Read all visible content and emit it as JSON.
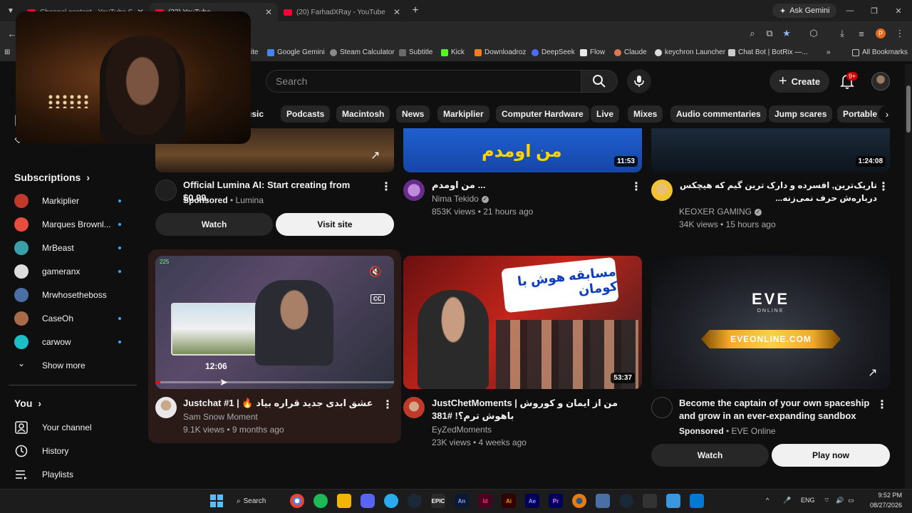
{
  "browser": {
    "tabs": [
      {
        "label": "Channel content - YouTube Stu"
      },
      {
        "label": "(22) YouTube"
      },
      {
        "label": "(20) FarhadXRay - YouTube"
      }
    ],
    "ask_gemini": "Ask Gemini",
    "profile_initial": "P"
  },
  "bookmarks": [
    {
      "label": "ite"
    },
    {
      "label": "Google Gemini",
      "color": "#4285f4"
    },
    {
      "label": "Steam Calculator",
      "color": "#8a8a8a"
    },
    {
      "label": "Subtitle",
      "color": "#6a6a6a"
    },
    {
      "label": "Kick",
      "color": "#53fc18"
    },
    {
      "label": "Downloadroz",
      "color": "#ff7a1a"
    },
    {
      "label": "DeepSeek",
      "color": "#4d6bfe"
    },
    {
      "label": "Flow",
      "color": "#e8e8e8"
    },
    {
      "label": "Claude",
      "color": "#d97757"
    },
    {
      "label": "keychron Launcher",
      "color": "#dddddd"
    },
    {
      "label": "Chat Bot | BotRix —...",
      "color": "#cccccc"
    },
    {
      "label": "All Bookmarks",
      "color": "#c7c7c7"
    }
  ],
  "header": {
    "search_placeholder": "Search",
    "create_label": "Create",
    "notif_count": "9+"
  },
  "chips": [
    "usic",
    "Podcasts",
    "Macintosh",
    "News",
    "Markiplier",
    "Computer Hardware",
    "Live",
    "Mixes",
    "Audio commentaries",
    "Jump scares",
    "Portable c"
  ],
  "sidebar": {
    "subscriptions_title": "Subscriptions",
    "subscriptions": [
      {
        "name": "Markiplier",
        "color": "#c0392b"
      },
      {
        "name": "Marques Brownl...",
        "color": "#e74c3c"
      },
      {
        "name": "MrBeast",
        "color": "#3aa0a8"
      },
      {
        "name": "gameranx",
        "color": "#dddddd"
      },
      {
        "name": "Mrwhosetheboss",
        "color": "#4a6fa5"
      },
      {
        "name": "CaseOh",
        "color": "#a86b4a"
      },
      {
        "name": "carwow",
        "color": "#1ac0c6"
      }
    ],
    "show_more": "Show more",
    "you_title": "You",
    "you_items": [
      {
        "label": "Your channel"
      },
      {
        "label": "History"
      },
      {
        "label": "Playlists"
      }
    ]
  },
  "videos": [
    {
      "title": "Official Lumina AI: Start creating from $0.99.",
      "sponsored": "Sponsored",
      "channel": "Lumina",
      "btn_primary": "Watch",
      "btn_secondary": "Visit site"
    },
    {
      "title": "من اومدم ...",
      "channel": "Nima Tekido",
      "meta": "853K views • 21 hours ago",
      "duration": "11:53",
      "thumb_text": "من اومدم"
    },
    {
      "title": "تاریک‌ترین, افسرده و دارک ترین گیم که هیچکس درباره‌ش حرف نمی‌زنه...",
      "channel": "KEOXER GAMING",
      "meta": "34K views • 15 hours ago",
      "duration": "1:24:08"
    },
    {
      "title": "Justchat #1 | 🔥 عشق ابدی جدید قراره بیاد",
      "channel": "Sam Snow Moment",
      "meta": "9.1K views • 9 months ago",
      "hover_time": "12:06",
      "hover_badge": "225",
      "cc": "CC",
      "progress": 0.02
    },
    {
      "title": "JustChetMoments | من از ایمان و کوروش باهوش ترم؟! #381",
      "channel": "EyZedMoments",
      "meta": "23K views • 4 weeks ago",
      "duration": "53:37",
      "thumb_text": "مسابقه هوش با کومان"
    },
    {
      "title": "Become the captain of your own spaceship and grow in an ever-expanding sandbox",
      "sponsored": "Sponsored",
      "channel": "EVE Online",
      "btn_primary": "Watch",
      "btn_secondary": "Play now",
      "thumb_logo": "EVE",
      "thumb_logo_sub": "ONLINE",
      "thumb_banner": "EVEONLINE.COM"
    }
  ],
  "taskbar": {
    "search": "Search",
    "lang": "ENG",
    "time": "9:52 PM",
    "date": "08/27/2026",
    "apps": [
      "An",
      "Id",
      "Ai",
      "Ae",
      "Pr"
    ]
  }
}
